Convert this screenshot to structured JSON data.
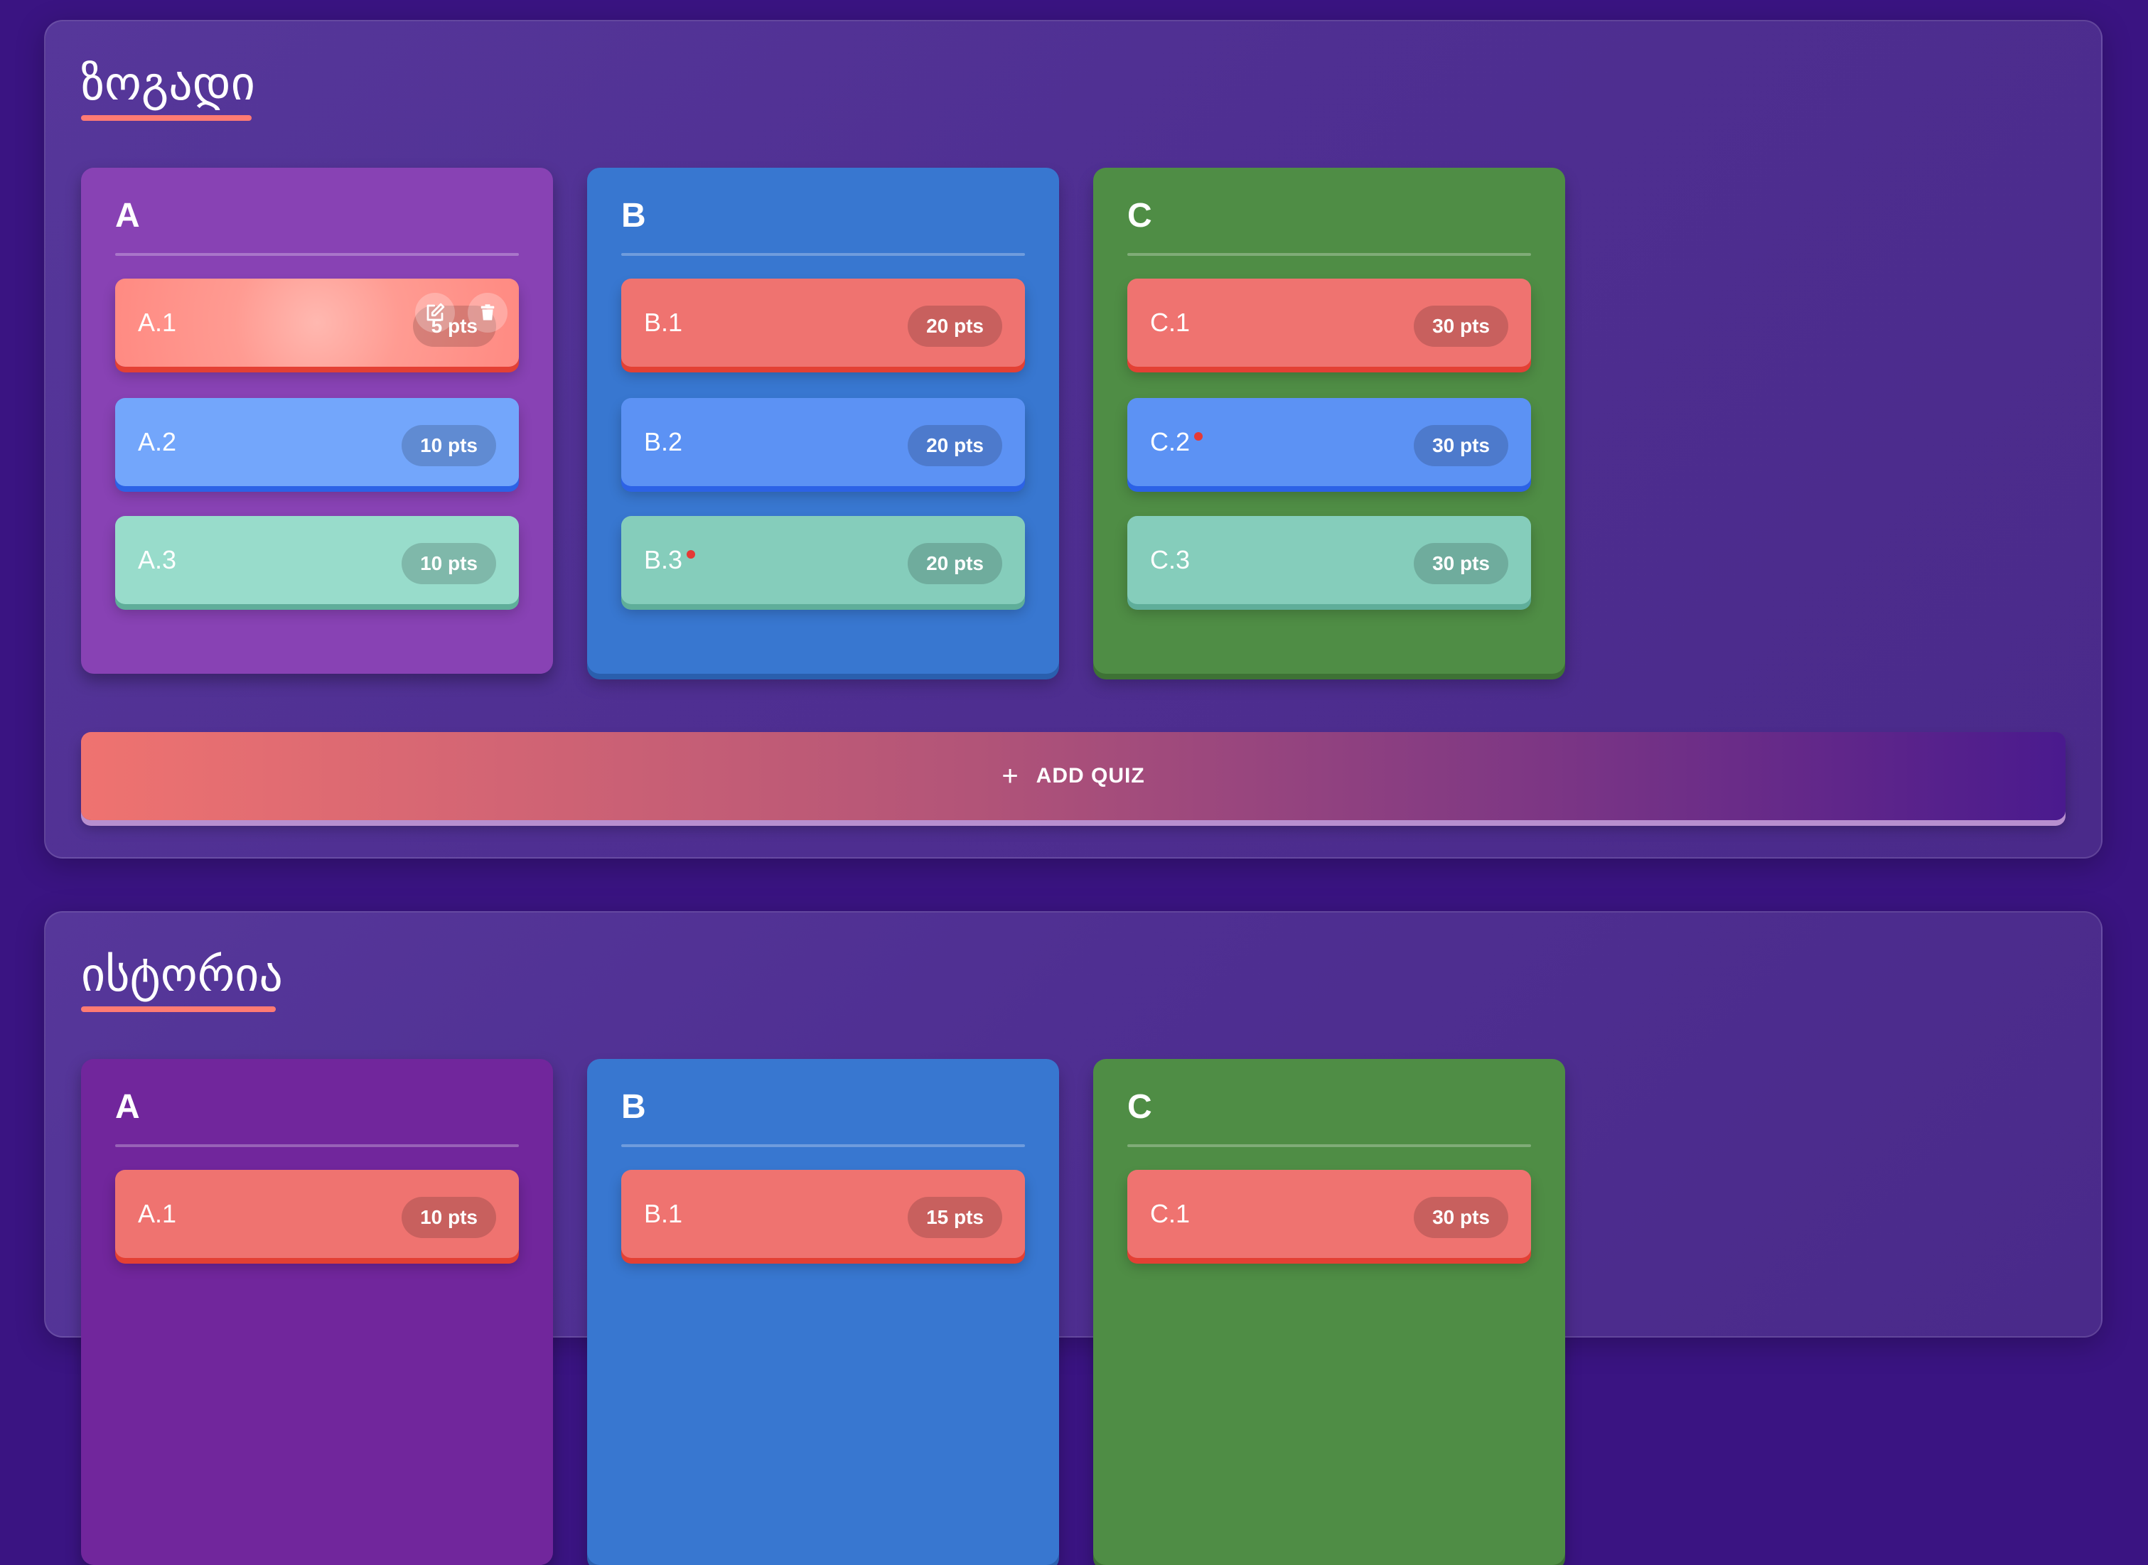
{
  "sections": [
    {
      "title": "ზოგადი",
      "columns": [
        {
          "letter": "A",
          "cards": [
            {
              "label": "A.1",
              "points": "5 pts",
              "required": false
            },
            {
              "label": "A.2",
              "points": "10 pts",
              "required": false
            },
            {
              "label": "A.3",
              "points": "10 pts",
              "required": false
            }
          ]
        },
        {
          "letter": "B",
          "cards": [
            {
              "label": "B.1",
              "points": "20 pts",
              "required": false
            },
            {
              "label": "B.2",
              "points": "20 pts",
              "required": false
            },
            {
              "label": "B.3",
              "points": "20 pts",
              "required": true
            }
          ]
        },
        {
          "letter": "C",
          "cards": [
            {
              "label": "C.1",
              "points": "30 pts",
              "required": false
            },
            {
              "label": "C.2",
              "points": "30 pts",
              "required": true
            },
            {
              "label": "C.3",
              "points": "30 pts",
              "required": false
            }
          ]
        }
      ],
      "add_button": "ADD QUIZ"
    },
    {
      "title": "ისტორია",
      "columns": [
        {
          "letter": "A",
          "cards": [
            {
              "label": "A.1",
              "points": "10 pts"
            }
          ]
        },
        {
          "letter": "B",
          "cards": [
            {
              "label": "B.1",
              "points": "15 pts"
            }
          ]
        },
        {
          "letter": "C",
          "cards": [
            {
              "label": "C.1",
              "points": "30 pts"
            }
          ]
        }
      ]
    }
  ],
  "colors": {
    "background": "#3a1482",
    "column_a": "#8842b4",
    "column_b": "#3877d0",
    "column_c": "#4f8d45",
    "card_red": "#ef7370",
    "card_blue": "#5c92f4",
    "card_teal": "#85cdbb",
    "accent": "#ff7b73"
  },
  "icons": {
    "edit": "edit-icon",
    "delete": "trash-icon",
    "add": "plus-icon"
  }
}
